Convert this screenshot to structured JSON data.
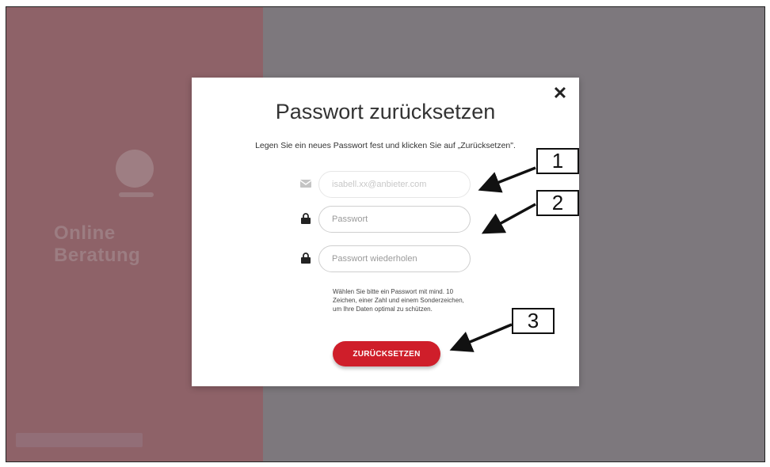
{
  "modal": {
    "title": "Passwort zurücksetzen",
    "instruction": "Legen Sie ein neues Passwort fest und klicken Sie auf „Zurücksetzen\".",
    "email_placeholder": "isabell.xx@anbieter.com",
    "password_placeholder": "Passwort",
    "password_repeat_placeholder": "Passwort wiederholen",
    "hint": "Wählen Sie bitte ein Passwort mit mind. 10 Zeichen, einer Zahl und einem Sonderzeichen, um Ihre Daten optimal zu schützen.",
    "submit_label": "ZURÜCKSETZEN",
    "close_glyph": "✕"
  },
  "background": {
    "title": "Online Beratung"
  },
  "callouts": [
    "1",
    "2",
    "3"
  ],
  "colors": {
    "accent": "#cf1e2a",
    "overlay_left": "#8e6268",
    "overlay_right": "#7d787d"
  },
  "icons": {
    "email": "envelope-icon",
    "password": "lock-icon",
    "password_repeat": "lock-icon",
    "close": "close-icon"
  }
}
